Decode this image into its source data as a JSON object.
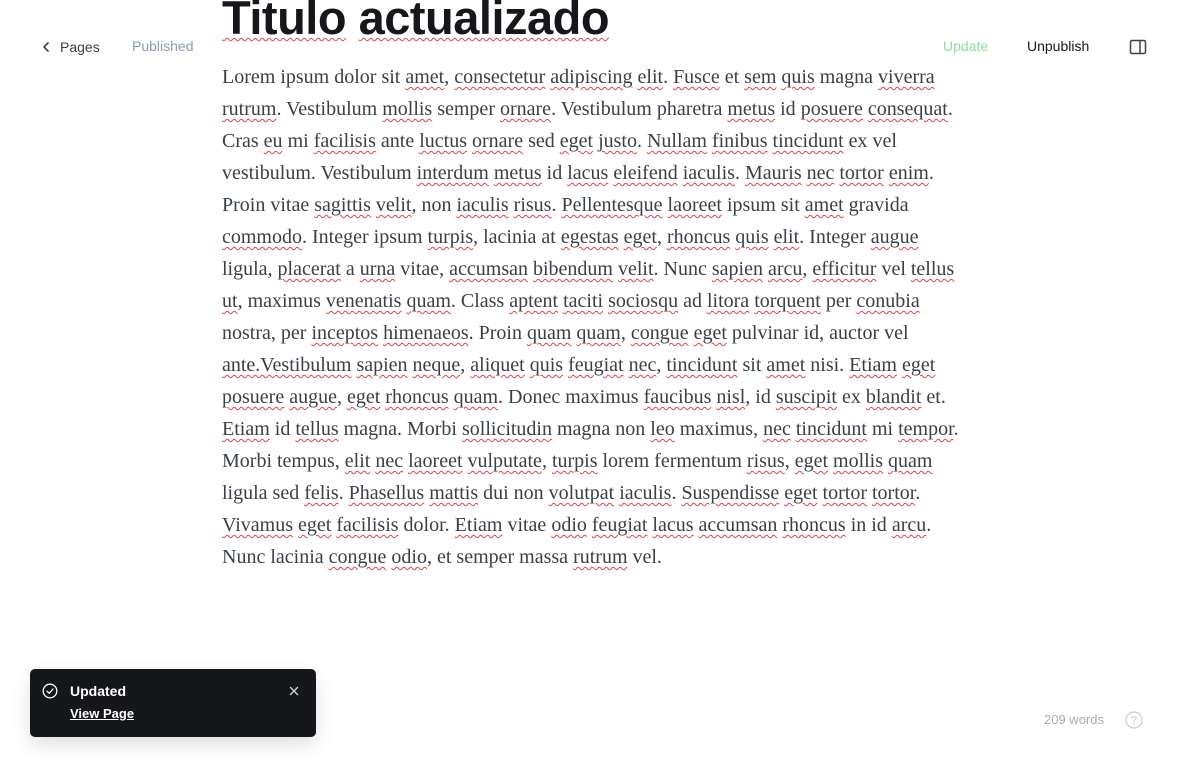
{
  "header": {
    "back_label": "Pages",
    "status": "Published",
    "update_label": "Update",
    "unpublish_label": "Unpublish"
  },
  "post": {
    "title": "Titulo actualizado",
    "body": "Lorem ipsum dolor sit amet, consectetur adipiscing elit. Fusce et sem quis magna viverra rutrum. Vestibulum mollis semper ornare. Vestibulum pharetra metus id posuere consequat. Cras eu mi facilisis ante luctus ornare sed eget justo. Nullam finibus tincidunt ex vel vestibulum. Vestibulum interdum metus id lacus eleifend iaculis. Mauris nec tortor enim. Proin vitae sagittis velit, non iaculis risus. Pellentesque laoreet ipsum sit amet gravida commodo. Integer ipsum turpis, lacinia at egestas eget, rhoncus quis elit. Integer augue ligula, placerat a urna vitae, accumsan bibendum velit. Nunc sapien arcu, efficitur vel tellus ut, maximus venenatis quam. Class aptent taciti sociosqu ad litora torquent per conubia nostra, per inceptos himenaeos. Proin quam quam, congue eget pulvinar id, auctor vel ante.Vestibulum sapien neque, aliquet quis feugiat nec, tincidunt sit amet nisi. Etiam eget posuere augue, eget rhoncus quam. Donec maximus faucibus nisl, id suscipit ex blandit et. Etiam id tellus magna. Morbi sollicitudin magna non leo maximus, nec tincidunt mi tempor. Morbi tempus, elit nec laoreet vulputate, turpis lorem fermentum risus, eget mollis quam ligula sed felis. Phasellus mattis dui non volutpat iaculis. Suspendisse eget tortor tortor. Vivamus eget facilisis dolor. Etiam vitae odio feugiat lacus accumsan rhoncus in id arcu. Nunc lacinia congue odio, et semper massa rutrum vel."
  },
  "toast": {
    "title": "Updated",
    "link_label": "View Page"
  },
  "footer": {
    "word_count": "209 words"
  },
  "spellcheck_flagged": [
    "Titulo",
    "actualizado",
    "amet",
    "consectetur",
    "adipiscing",
    "elit",
    "Fusce",
    "sem",
    "quis",
    "viverra",
    "rutrum",
    "mollis",
    "ornare",
    "metus",
    "posuere",
    "consequat",
    "eu",
    "facilisis",
    "luctus",
    "eget",
    "justo",
    "Nullam",
    "finibus",
    "tincidunt",
    "interdum",
    "lacus",
    "eleifend",
    "iaculis",
    "Mauris",
    "nec",
    "tortor",
    "enim",
    "sagittis",
    "velit",
    "risus",
    "Pellentesque",
    "laoreet",
    "commodo",
    "turpis",
    "egestas",
    "rhoncus",
    "augue",
    "placerat",
    "urna",
    "accumsan",
    "bibendum",
    "sapien",
    "arcu",
    "efficitur",
    "tellus",
    "ut",
    "venenatis",
    "quam",
    "aptent",
    "taciti",
    "sociosqu",
    "litora",
    "torquent",
    "conubia",
    "inceptos",
    "himenaeos",
    "congue",
    "ante.Vestibulum",
    "neque",
    "aliquet",
    "feugiat",
    "Etiam",
    "faucibus",
    "nisl",
    "suscipit",
    "blandit",
    "sollicitudin",
    "leo",
    "tempor",
    "vulputate",
    "felis",
    "Phasellus",
    "mattis",
    "volutpat",
    "Suspendisse",
    "Vivamus",
    "odio"
  ],
  "colors": {
    "accent_update": "#8fdd9a",
    "spellcheck_underline": "#e5404a",
    "toast_bg": "#15171a"
  }
}
